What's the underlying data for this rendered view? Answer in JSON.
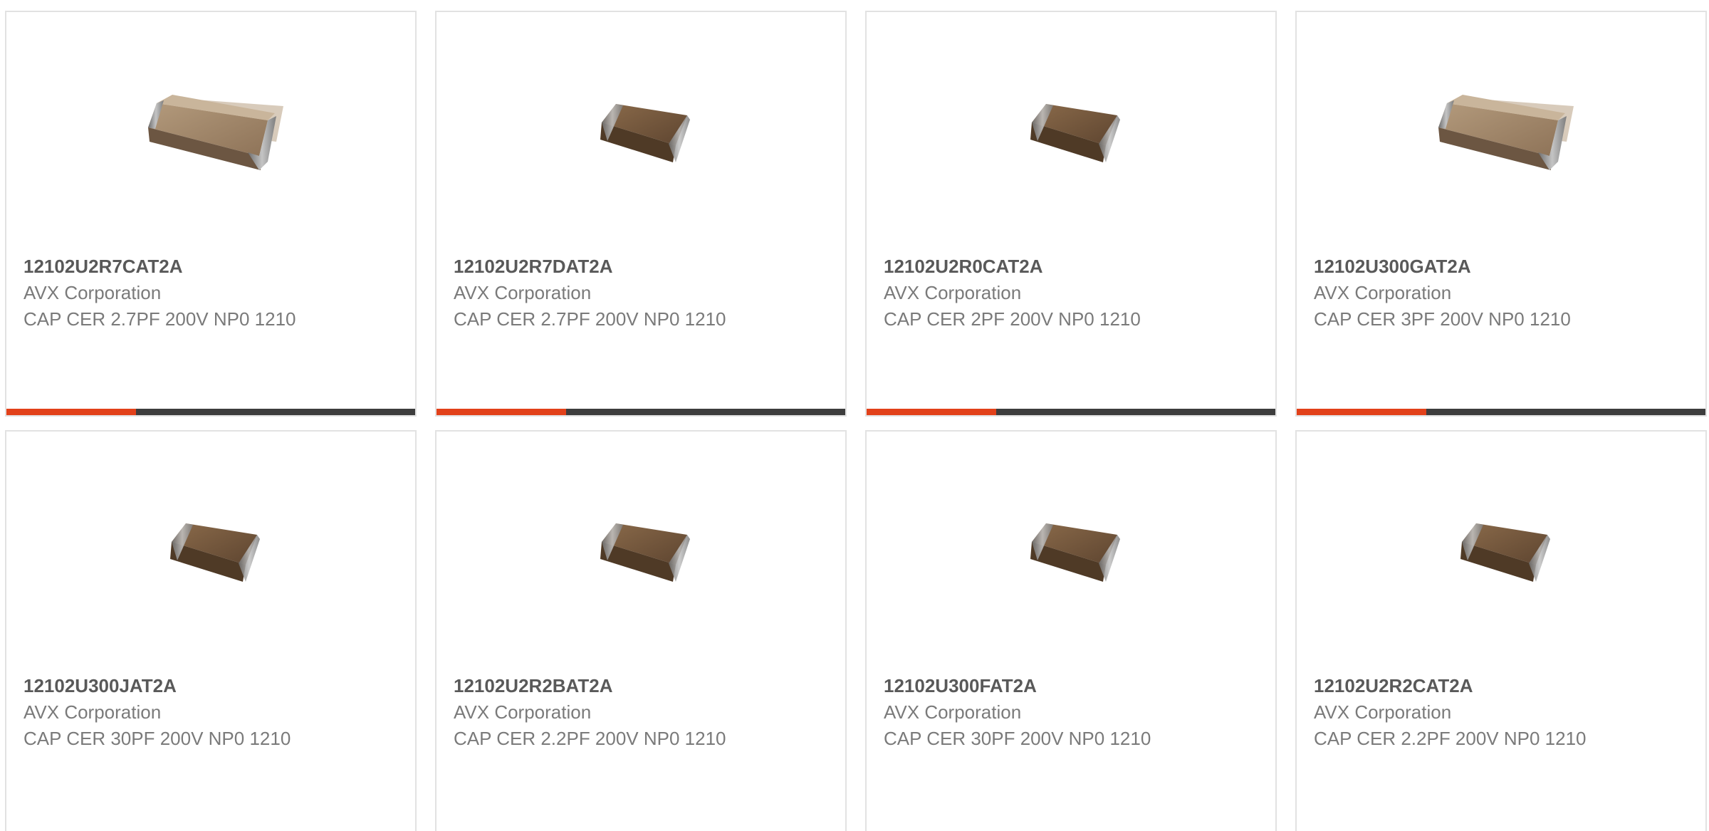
{
  "products": [
    {
      "part_number": "12102U2R7CAT2A",
      "manufacturer": "AVX Corporation",
      "description": "CAP CER 2.7PF 200V NP0 1210",
      "image": "large-chip-capacitor"
    },
    {
      "part_number": "12102U2R7DAT2A",
      "manufacturer": "AVX Corporation",
      "description": "CAP CER 2.7PF 200V NP0 1210",
      "image": "small-chip-capacitor"
    },
    {
      "part_number": "12102U2R0CAT2A",
      "manufacturer": "AVX Corporation",
      "description": "CAP CER 2PF 200V NP0 1210",
      "image": "small-chip-capacitor"
    },
    {
      "part_number": "12102U300GAT2A",
      "manufacturer": "AVX Corporation",
      "description": "CAP CER 3PF 200V NP0 1210",
      "image": "large-chip-capacitor"
    },
    {
      "part_number": "12102U300JAT2A",
      "manufacturer": "AVX Corporation",
      "description": "CAP CER 30PF 200V NP0 1210",
      "image": "small-chip-capacitor"
    },
    {
      "part_number": "12102U2R2BAT2A",
      "manufacturer": "AVX Corporation",
      "description": "CAP CER 2.2PF 200V NP0 1210",
      "image": "small-chip-capacitor"
    },
    {
      "part_number": "12102U300FAT2A",
      "manufacturer": "AVX Corporation",
      "description": "CAP CER 30PF 200V NP0 1210",
      "image": "small-chip-capacitor"
    },
    {
      "part_number": "12102U2R2CAT2A",
      "manufacturer": "AVX Corporation",
      "description": "CAP CER 2.2PF 200V NP0 1210",
      "image": "small-chip-capacitor"
    }
  ],
  "colors": {
    "accent": "#e2411a",
    "bar": "#3d3d3d",
    "border": "#e2e2e2",
    "part_number_text": "#595959",
    "body_text": "#7a7a7a"
  }
}
